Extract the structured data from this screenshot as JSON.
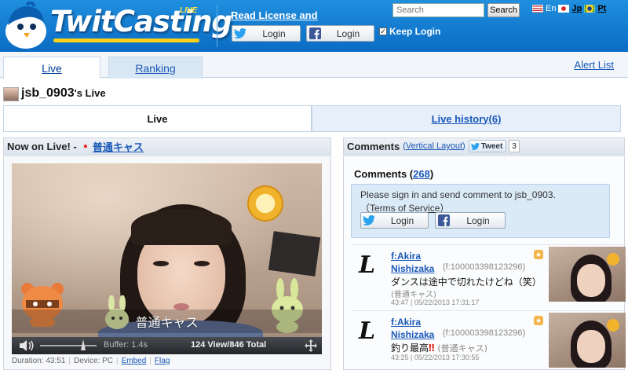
{
  "header": {
    "logo_text": "TwitCasting",
    "logo_badge": "LIVE",
    "read_license": "Read License and",
    "twitter_login_label": "Login",
    "facebook_login_label": "Login",
    "keep_login_label": "Keep Login",
    "keep_login_checked": "✓",
    "search_placeholder": "Search",
    "search_button": "Search",
    "languages": [
      "En",
      "Jp",
      "Pt"
    ],
    "active_language": "Jp"
  },
  "nav": {
    "tabs": [
      {
        "label": "Live"
      },
      {
        "label": "Ranking"
      }
    ],
    "alert_list": "Alert List"
  },
  "page": {
    "username": "jsb_0903",
    "title_suffix": "'s Live"
  },
  "subtabs": {
    "live": "Live",
    "history": "Live history(6)"
  },
  "left_panel": {
    "now_on_live": "Now on Live! -",
    "live_title": "普通キャス",
    "video_caption": "普通キャス",
    "buffer": "Buffer: 1.4s",
    "views": "124 View/846 Total",
    "duration": "Duration: 43:51",
    "device": "Device: PC",
    "embed": "Embed",
    "flag": "Flag"
  },
  "right_panel": {
    "comments_title": "Comments",
    "vertical_layout": "Vertical Layout",
    "tweet_label": "Tweet",
    "tweet_count": "3",
    "comments_label": "Comments",
    "comments_count": "268",
    "signin_message": "Please sign in and send comment to jsb_0903.",
    "terms_open": "（",
    "terms_label": "Terms of Service",
    "terms_close": "）",
    "twitter_login_label": "Login",
    "facebook_login_label": "Login",
    "comments": [
      {
        "name_line1": "f:Akira",
        "name_line2": "Nishizaka",
        "user_id": "(f:100003398123296)",
        "text": "ダンスは途中で切れたけどね（笑）",
        "live_tag": "(普通キャス)",
        "time": "43:47 | 05/22/2013 17:31:17"
      },
      {
        "name_line1": "f:Akira",
        "name_line2": "Nishizaka",
        "user_id": "(f:100003398123296)",
        "text": "釣り最高",
        "exclaim": "‼",
        "live_tag": "(普通キャス)",
        "time": "43:25 | 05/22/2013 17:30:55"
      }
    ]
  },
  "colors": {
    "header_blue": "#0a6cc4",
    "link_blue": "#1a59b8",
    "logo_yellow": "#ffd21a",
    "live_dot": "#e22222"
  }
}
